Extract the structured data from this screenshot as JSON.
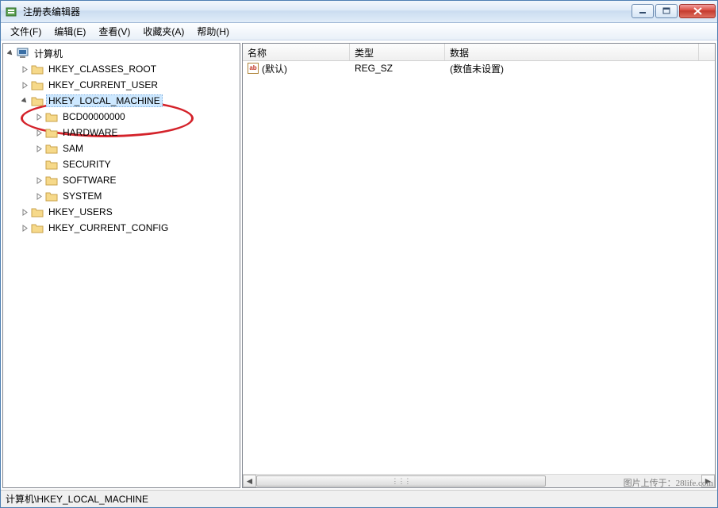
{
  "window": {
    "title": "注册表编辑器"
  },
  "menu": {
    "file": "文件(F)",
    "edit": "编辑(E)",
    "view": "查看(V)",
    "fav": "收藏夹(A)",
    "help": "帮助(H)"
  },
  "tree": {
    "root": "计算机",
    "hkcr": "HKEY_CLASSES_ROOT",
    "hkcu": "HKEY_CURRENT_USER",
    "hklm": "HKEY_LOCAL_MACHINE",
    "hklm_children": {
      "bcd": "BCD00000000",
      "hardware": "HARDWARE",
      "sam": "SAM",
      "security": "SECURITY",
      "software": "SOFTWARE",
      "system": "SYSTEM"
    },
    "hku": "HKEY_USERS",
    "hkcc": "HKEY_CURRENT_CONFIG"
  },
  "list": {
    "headers": {
      "name": "名称",
      "type": "类型",
      "data": "数据"
    },
    "rows": [
      {
        "name": "(默认)",
        "type": "REG_SZ",
        "data": "(数值未设置)"
      }
    ]
  },
  "status": {
    "path": "计算机\\HKEY_LOCAL_MACHINE"
  },
  "watermark": "图片上传于：28life.com",
  "col_widths": {
    "name": 135,
    "type": 120,
    "data": 320
  }
}
